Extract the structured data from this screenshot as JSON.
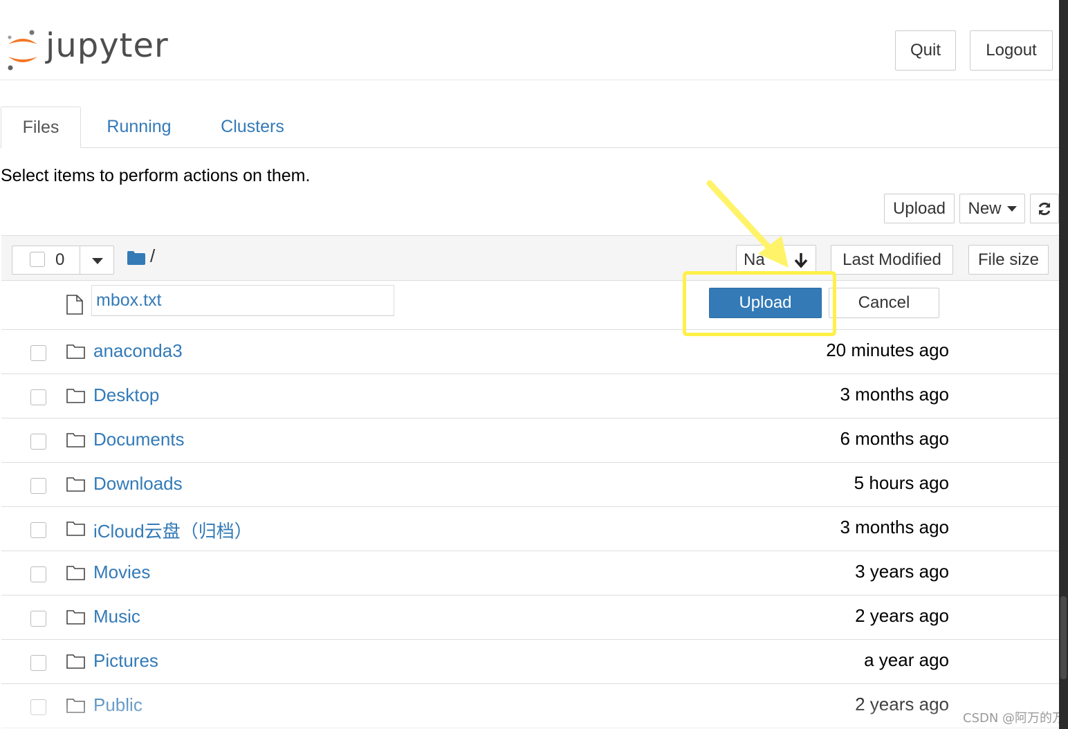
{
  "app": {
    "logo_text": "jupyter",
    "brand_color": "#f37726",
    "link_color": "#337ab7",
    "quit_label": "Quit",
    "logout_label": "Logout"
  },
  "tabs": [
    {
      "label": "Files",
      "active": true
    },
    {
      "label": "Running",
      "active": false
    },
    {
      "label": "Clusters",
      "active": false
    }
  ],
  "instructions": "Select items to perform actions on them.",
  "toolbar": {
    "upload_label": "Upload",
    "new_label": "New",
    "refresh_icon": "refresh-icon"
  },
  "list_header": {
    "selected_count": "0",
    "breadcrumb": "/",
    "sort_name_label": "Name",
    "sort_name_visible": "Na",
    "last_modified_label": "Last Modified",
    "file_size_label": "File size"
  },
  "upload_row": {
    "filename": "mbox.txt",
    "upload_label": "Upload",
    "cancel_label": "Cancel"
  },
  "items": [
    {
      "name": "anaconda3",
      "type": "folder",
      "modified": "20 minutes ago"
    },
    {
      "name": "Desktop",
      "type": "folder",
      "modified": "3 months ago"
    },
    {
      "name": "Documents",
      "type": "folder",
      "modified": "6 months ago"
    },
    {
      "name": "Downloads",
      "type": "folder",
      "modified": "5 hours ago"
    },
    {
      "name": "iCloud云盘（归档）",
      "type": "folder",
      "modified": "3 months ago"
    },
    {
      "name": "Movies",
      "type": "folder",
      "modified": "3 years ago"
    },
    {
      "name": "Music",
      "type": "folder",
      "modified": "2 years ago"
    },
    {
      "name": "Pictures",
      "type": "folder",
      "modified": "a year ago"
    },
    {
      "name": "Public",
      "type": "folder",
      "modified": "2 years ago"
    }
  ],
  "annotation": {
    "highlight_color": "#fff048",
    "arrow_color": "#fff36a"
  },
  "watermark": "CSDN @阿万的万"
}
